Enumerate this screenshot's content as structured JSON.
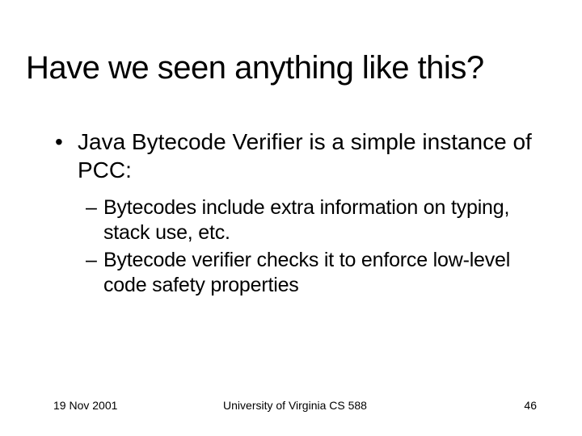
{
  "title": "Have we seen anything like this?",
  "bullets": {
    "lvl1": [
      "Java Bytecode Verifier is a simple instance of PCC:"
    ],
    "lvl2": [
      "Bytecodes include extra information on typing, stack use, etc.",
      "Bytecode verifier checks it to enforce low-level code  safety properties"
    ]
  },
  "footer": {
    "date": "19 Nov 2001",
    "center": "University of Virginia CS 588",
    "page": "46"
  }
}
